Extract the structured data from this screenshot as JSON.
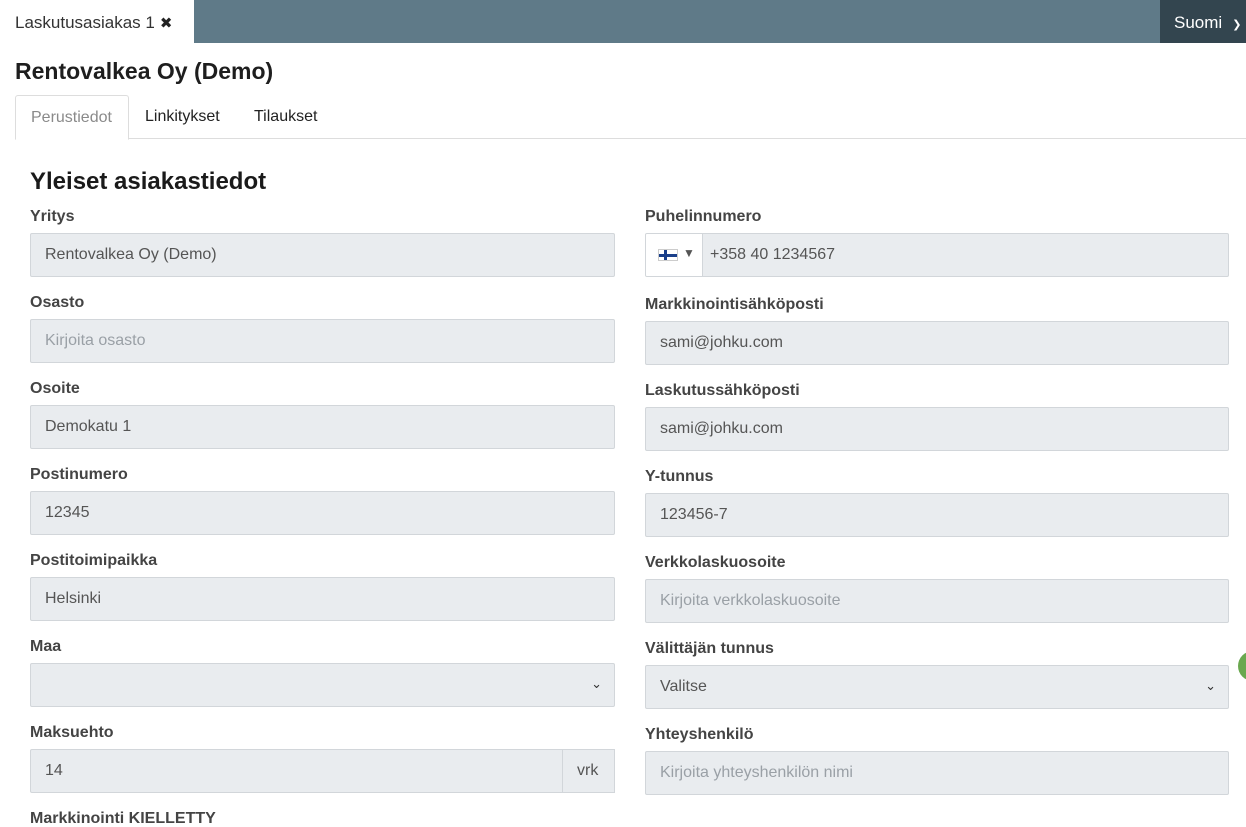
{
  "topbar": {
    "doc_tab_label": "Laskutusasiakas 1",
    "language": "Suomi"
  },
  "page_title": "Rentovalkea Oy (Demo)",
  "tabs": [
    {
      "label": "Perustiedot",
      "active": true
    },
    {
      "label": "Linkitykset",
      "active": false
    },
    {
      "label": "Tilaukset",
      "active": false
    }
  ],
  "section_title": "Yleiset asiakastiedot",
  "left": {
    "yritys": {
      "label": "Yritys",
      "value": "Rentovalkea Oy (Demo)"
    },
    "osasto": {
      "label": "Osasto",
      "value": "",
      "placeholder": "Kirjoita osasto"
    },
    "osoite": {
      "label": "Osoite",
      "value": "Demokatu 1"
    },
    "postinumero": {
      "label": "Postinumero",
      "value": "12345"
    },
    "postitoimipaikka": {
      "label": "Postitoimipaikka",
      "value": "Helsinki"
    },
    "maa": {
      "label": "Maa",
      "value": ""
    },
    "maksuehto": {
      "label": "Maksuehto",
      "value": "14",
      "unit": "vrk"
    },
    "markkinointi": {
      "label": "Markkinointi KIELLETTY"
    }
  },
  "right": {
    "puhelinnumero": {
      "label": "Puhelinnumero",
      "value": "+358 40 1234567"
    },
    "markkinointisahkoposti": {
      "label": "Markkinointisähköposti",
      "value": "sami@johku.com"
    },
    "laskutussahkoposti": {
      "label": "Laskutussähköposti",
      "value": "sami@johku.com"
    },
    "ytunnus": {
      "label": "Y-tunnus",
      "value": "123456-7"
    },
    "verkkolaskuosoite": {
      "label": "Verkkolaskuosoite",
      "value": "",
      "placeholder": "Kirjoita verkkolaskuosoite"
    },
    "valittajan_tunnus": {
      "label": "Välittäjän tunnus",
      "value": "Valitse"
    },
    "yhteyshenkilo": {
      "label": "Yhteyshenkilö",
      "value": "",
      "placeholder": "Kirjoita yhteyshenkilön nimi"
    }
  },
  "colors": {
    "topbar": "#5f7a88",
    "language_button": "#33454f",
    "field_background": "#e9ecef",
    "floating_indicator": "#6aa84f"
  }
}
